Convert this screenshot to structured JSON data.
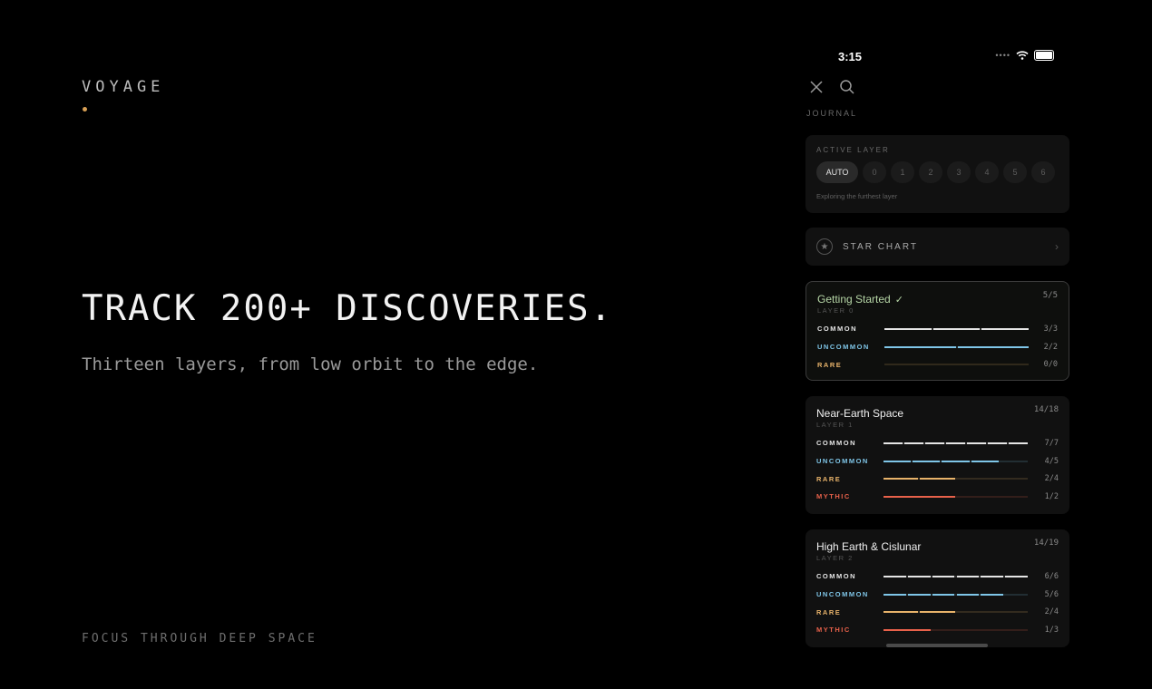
{
  "brand": "VOYAGE",
  "headline": "TRACK 200+ DISCOVERIES.",
  "subline": "Thirteen layers, from low orbit to the edge.",
  "footer": "FOCUS THROUGH DEEP SPACE",
  "colors": {
    "accent": "#d9a055",
    "common": "#e6e6e6",
    "uncommon": "#7fc6e8",
    "rare": "#e8b36a",
    "mythic": "#e8614a",
    "done": "#b6d6a6"
  },
  "phone": {
    "time": "3:15",
    "section_title": "JOURNAL",
    "active_layer": {
      "label": "ACTIVE LAYER",
      "chips": [
        "AUTO",
        "0",
        "1",
        "2",
        "3",
        "4",
        "5",
        "6"
      ],
      "selected": "AUTO",
      "caption": "Exploring the furthest layer"
    },
    "star_chart": {
      "label": "STAR CHART"
    },
    "cards": [
      {
        "title": "Getting Started",
        "check": "✓",
        "layer": "LAYER 0",
        "count": "5/5",
        "rows": [
          {
            "label": "COMMON",
            "count": "3/3",
            "done": 3,
            "total": 3
          },
          {
            "label": "UNCOMMON",
            "count": "2/2",
            "done": 2,
            "total": 2
          },
          {
            "label": "RARE",
            "count": "0/0",
            "done": 0,
            "total": 0
          }
        ]
      },
      {
        "title": "Near-Earth Space",
        "layer": "LAYER 1",
        "count": "14/18",
        "rows": [
          {
            "label": "COMMON",
            "count": "7/7",
            "done": 7,
            "total": 7
          },
          {
            "label": "UNCOMMON",
            "count": "4/5",
            "done": 4,
            "total": 5
          },
          {
            "label": "RARE",
            "count": "2/4",
            "done": 2,
            "total": 4
          },
          {
            "label": "MYTHIC",
            "count": "1/2",
            "done": 1,
            "total": 2
          }
        ]
      },
      {
        "title": "High Earth & Cislunar",
        "layer": "LAYER 2",
        "count": "14/19",
        "rows": [
          {
            "label": "COMMON",
            "count": "6/6",
            "done": 6,
            "total": 6
          },
          {
            "label": "UNCOMMON",
            "count": "5/6",
            "done": 5,
            "total": 6
          },
          {
            "label": "RARE",
            "count": "2/4",
            "done": 2,
            "total": 4
          },
          {
            "label": "MYTHIC",
            "count": "1/3",
            "done": 1,
            "total": 3
          }
        ]
      }
    ]
  }
}
